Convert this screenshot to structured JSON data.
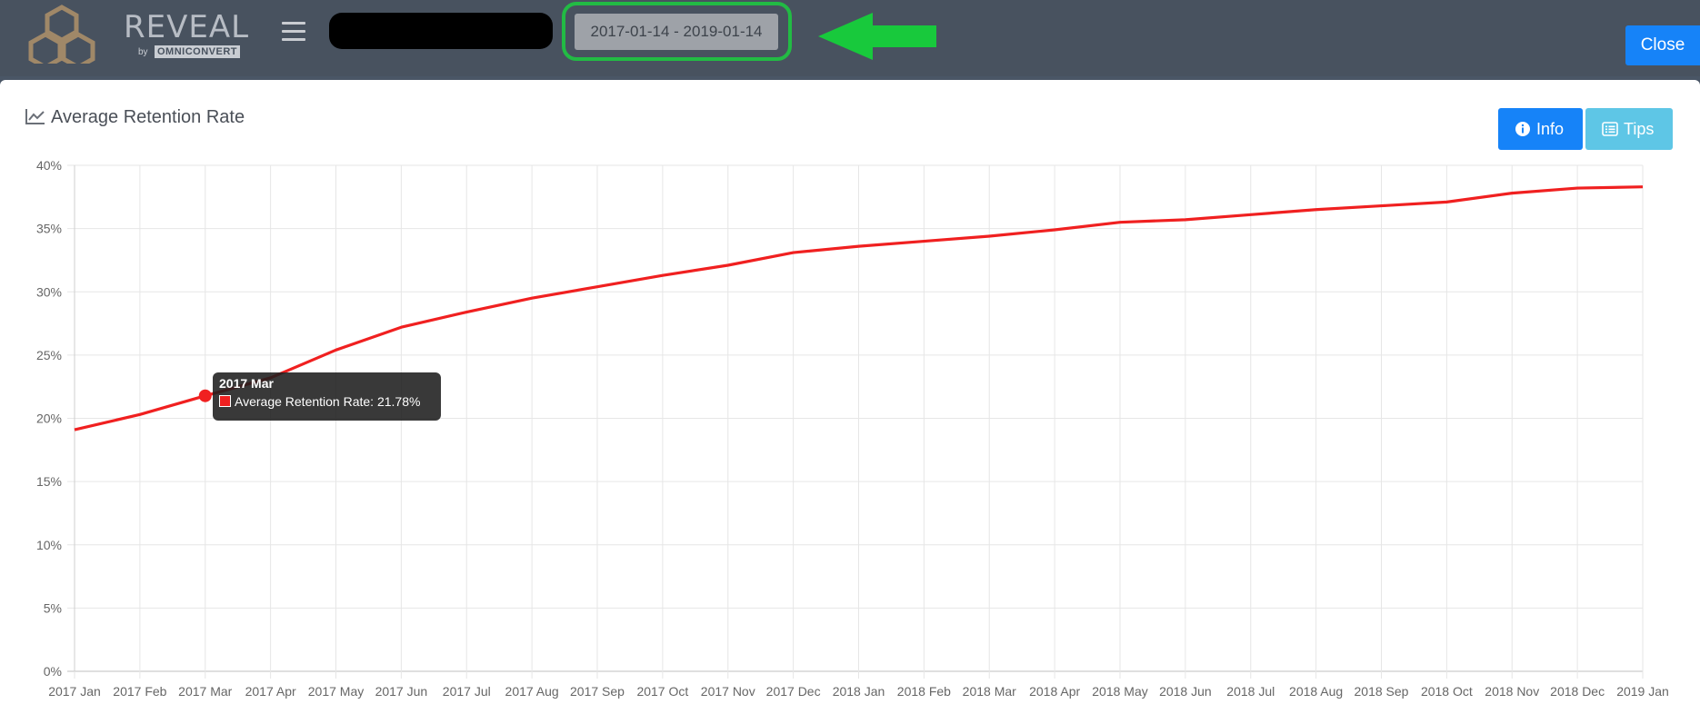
{
  "topbar": {
    "logo_text": "REVEAL",
    "logo_by": "by",
    "logo_brand": "OMNICONVERT",
    "menu_icon": "hamburger-icon",
    "date_range": "2017-01-14 - 2019-01-14",
    "close_label": "Close",
    "highlight_color": "#22bb44",
    "arrow_color": "#18c93c"
  },
  "panel": {
    "title": "Average Retention Rate",
    "title_icon": "line-chart-icon",
    "info_label": "Info",
    "info_icon": "info-circle-icon",
    "tips_label": "Tips",
    "tips_icon": "list-icon"
  },
  "tooltip": {
    "title": "2017 Mar",
    "series": "Average Retention Rate",
    "value": "21.78%",
    "text": "Average Retention Rate: 21.78%"
  },
  "chart_data": {
    "type": "line",
    "title": "Average Retention Rate",
    "categories": [
      "2017 Jan",
      "2017 Feb",
      "2017 Mar",
      "2017 Apr",
      "2017 May",
      "2017 Jun",
      "2017 Jul",
      "2017 Aug",
      "2017 Sep",
      "2017 Oct",
      "2017 Nov",
      "2017 Dec",
      "2018 Jan",
      "2018 Feb",
      "2018 Mar",
      "2018 Apr",
      "2018 May",
      "2018 Jun",
      "2018 Jul",
      "2018 Aug",
      "2018 Sep",
      "2018 Oct",
      "2018 Nov",
      "2018 Dec",
      "2019 Jan"
    ],
    "series": [
      {
        "name": "Average Retention Rate",
        "color": "#f02020",
        "values": [
          19.1,
          20.3,
          21.78,
          23.2,
          25.4,
          27.2,
          28.4,
          29.5,
          30.4,
          31.3,
          32.1,
          33.1,
          33.6,
          34.0,
          34.4,
          34.9,
          35.5,
          35.7,
          36.1,
          36.5,
          36.8,
          37.1,
          37.8,
          38.2,
          38.3
        ]
      }
    ],
    "ylim": [
      0,
      40
    ],
    "yticks": [
      "0%",
      "5%",
      "10%",
      "15%",
      "20%",
      "25%",
      "30%",
      "35%",
      "40%"
    ],
    "grid": true,
    "highlighted_index": 2
  }
}
